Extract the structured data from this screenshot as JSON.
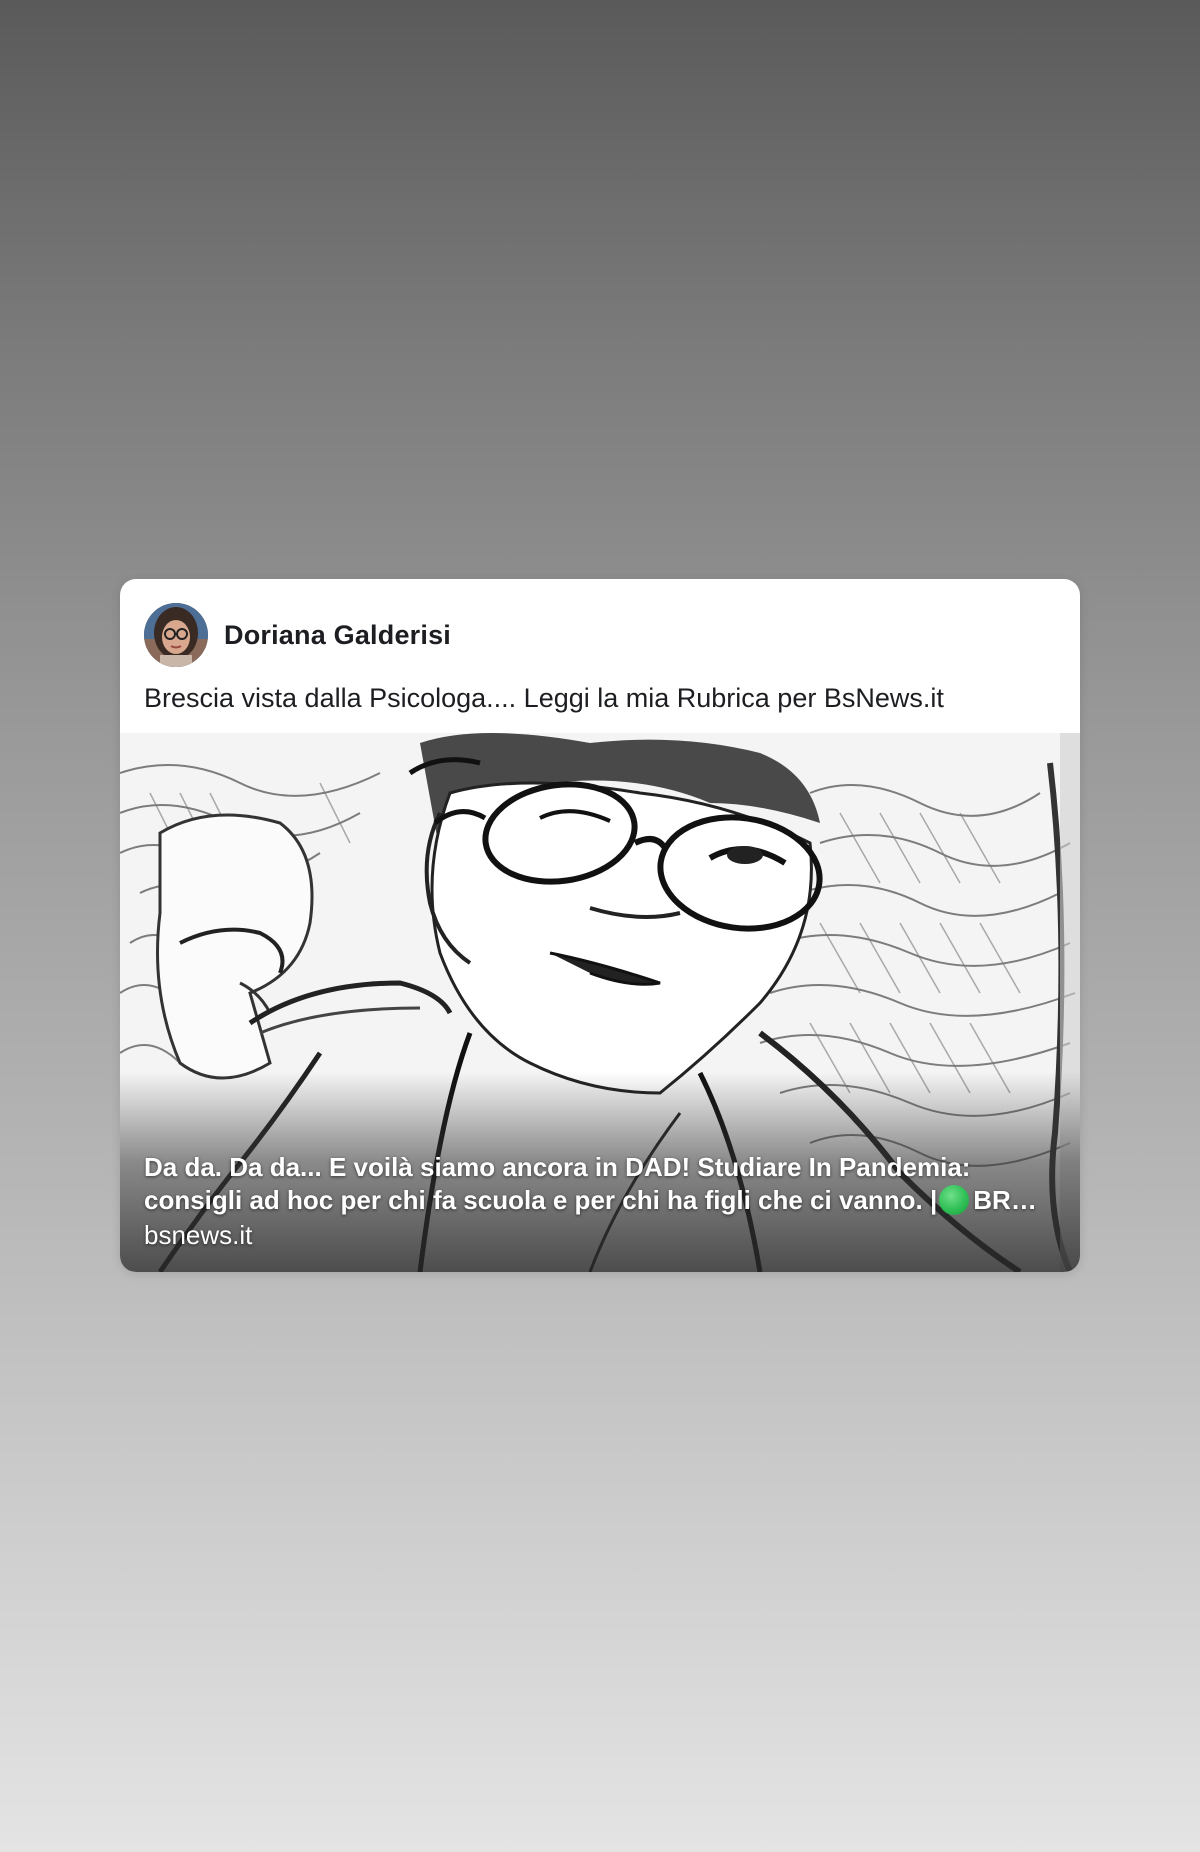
{
  "post": {
    "author_name": "Doriana Galderisi",
    "text": "Brescia vista dalla Psicologa.... Leggi la mia Rubrica per BsNews.it"
  },
  "link_preview": {
    "title_line1": "Da da. Da da... E voilà siamo ancora in DAD! Studiare In Pandemia:",
    "title_line2": "consigli ad hoc per chi fa scuola e per chi ha figli che ci vanno. |",
    "title_suffix": "BR…",
    "status_dot_color": "#2fbf55",
    "domain": "bsnews.it"
  },
  "icons": {
    "avatar": "profile-photo",
    "status": "green-circle-emoji"
  }
}
